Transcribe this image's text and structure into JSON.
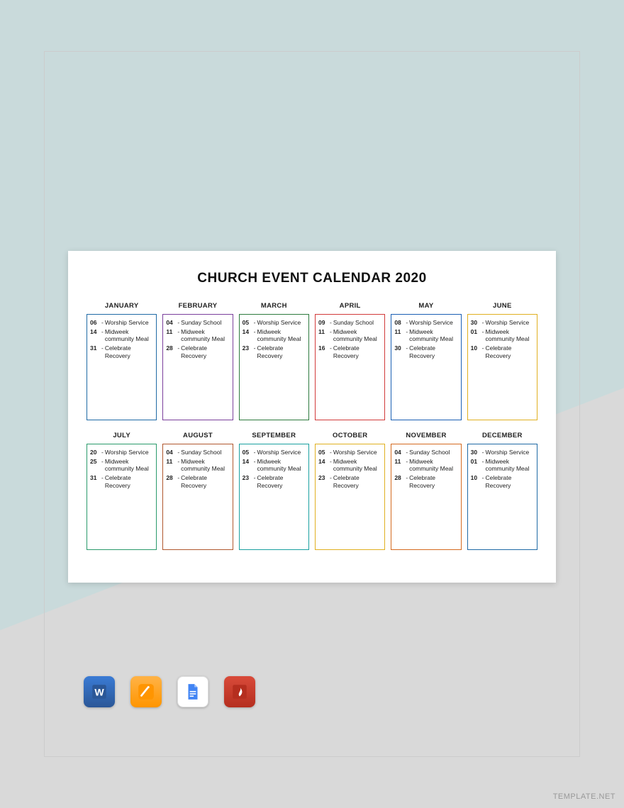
{
  "title": "CHURCH EVENT CALENDAR 2020",
  "watermark": "TEMPLATE.NET",
  "icons": [
    "W",
    "✎",
    "≡",
    "⬇"
  ],
  "months": [
    {
      "name": "JANUARY",
      "color": "#1f6aa5",
      "events": [
        {
          "d": "06",
          "t": "Worship Service"
        },
        {
          "d": "14",
          "t": "Midweek community Meal"
        },
        {
          "d": "31",
          "t": "Celebrate Recovery"
        }
      ]
    },
    {
      "name": "FEBRUARY",
      "color": "#7a3f9c",
      "events": [
        {
          "d": "04",
          "t": "Sunday School"
        },
        {
          "d": "11",
          "t": "Midweek community Meal"
        },
        {
          "d": "28",
          "t": "Celebrate Recovery"
        }
      ]
    },
    {
      "name": "MARCH",
      "color": "#2d7a3e",
      "events": [
        {
          "d": "05",
          "t": "Worship Service"
        },
        {
          "d": "14",
          "t": "Midweek community Meal"
        },
        {
          "d": "23",
          "t": "Celebrate Recovery"
        }
      ]
    },
    {
      "name": "APRIL",
      "color": "#d13a3a",
      "events": [
        {
          "d": "09",
          "t": "Sunday School"
        },
        {
          "d": "11",
          "t": "Midweek community Meal"
        },
        {
          "d": "16",
          "t": "Celebrate Recovery"
        }
      ]
    },
    {
      "name": "MAY",
      "color": "#1a5fb4",
      "events": [
        {
          "d": "08",
          "t": "Worship Service"
        },
        {
          "d": "11",
          "t": "Midweek community Meal"
        },
        {
          "d": "30",
          "t": "Celebrate Recovery"
        }
      ]
    },
    {
      "name": "JUNE",
      "color": "#e0b020",
      "events": [
        {
          "d": "30",
          "t": "Worship Service"
        },
        {
          "d": "01",
          "t": "Midweek community Meal"
        },
        {
          "d": "10",
          "t": "Celebrate Recovery"
        }
      ]
    },
    {
      "name": "JULY",
      "color": "#2a9a6b",
      "events": [
        {
          "d": "20",
          "t": "Worship Service"
        },
        {
          "d": "25",
          "t": "Midweek community Meal"
        },
        {
          "d": "31",
          "t": "Celebrate Recovery"
        }
      ]
    },
    {
      "name": "AUGUST",
      "color": "#b0572e",
      "events": [
        {
          "d": "04",
          "t": "Sunday School"
        },
        {
          "d": "11",
          "t": "Midweek community Meal"
        },
        {
          "d": "28",
          "t": "Celebrate Recovery"
        }
      ]
    },
    {
      "name": "SEPTEMBER",
      "color": "#1aa0a0",
      "events": [
        {
          "d": "05",
          "t": "Worship Service"
        },
        {
          "d": "14",
          "t": "Midweek community Meal"
        },
        {
          "d": "23",
          "t": "Celebrate Recovery"
        }
      ]
    },
    {
      "name": "OCTOBER",
      "color": "#e0b020",
      "events": [
        {
          "d": "05",
          "t": "Worship Service"
        },
        {
          "d": "14",
          "t": "Midweek community Meal"
        },
        {
          "d": "23",
          "t": "Celebrate Recovery"
        }
      ]
    },
    {
      "name": "NOVEMBER",
      "color": "#d46a1f",
      "events": [
        {
          "d": "04",
          "t": "Sunday School"
        },
        {
          "d": "11",
          "t": "Midweek community Meal"
        },
        {
          "d": "28",
          "t": "Celebrate Recovery"
        }
      ]
    },
    {
      "name": "DECEMBER",
      "color": "#1f6aa5",
      "events": [
        {
          "d": "30",
          "t": "Worship Service"
        },
        {
          "d": "01",
          "t": "Midweek community Meal"
        },
        {
          "d": "10",
          "t": "Celebrate Recovery"
        }
      ]
    }
  ]
}
